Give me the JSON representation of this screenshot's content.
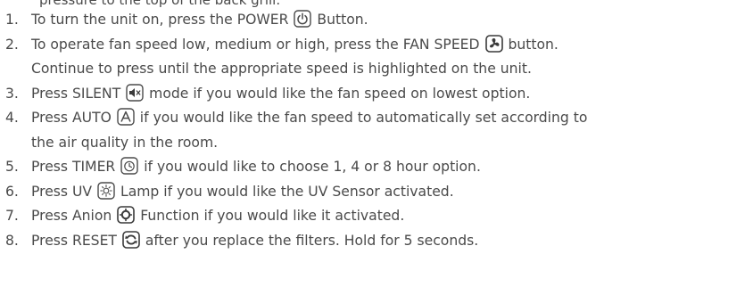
{
  "partial_top_line": "pressure to the top of the back grill.",
  "steps": [
    {
      "num": "1.",
      "before": "To turn the unit on, press the POWER ",
      "icon": "power-icon",
      "after": " Button."
    },
    {
      "num": "2.",
      "before": "To operate fan speed low, medium or high, press the FAN SPEED ",
      "icon": "fan-icon",
      "after": " button.",
      "continuation": "Continue to press until the appropriate speed is highlighted on the unit."
    },
    {
      "num": "3.",
      "before": "Press SILENT ",
      "icon": "mute-icon",
      "after": " mode if you would like the fan speed on lowest option."
    },
    {
      "num": "4.",
      "before": "Press AUTO ",
      "icon": "auto-icon",
      "after": " if you would like the fan speed to automatically set according to",
      "continuation": "the air quality in the room."
    },
    {
      "num": "5.",
      "before": "Press TIMER ",
      "icon": "timer-icon",
      "after": " if you would like to choose 1, 4 or 8 hour option."
    },
    {
      "num": "6.",
      "before": "Press UV ",
      "icon": "uv-lamp-icon",
      "after": " Lamp if you would like the UV Sensor activated."
    },
    {
      "num": "7.",
      "before": "Press Anion ",
      "icon": "anion-icon",
      "after": " Function if you would like it activated."
    },
    {
      "num": "8.",
      "before": "Press RESET ",
      "icon": "reset-icon",
      "after": " after you replace the filters. Hold for 5 seconds."
    }
  ]
}
